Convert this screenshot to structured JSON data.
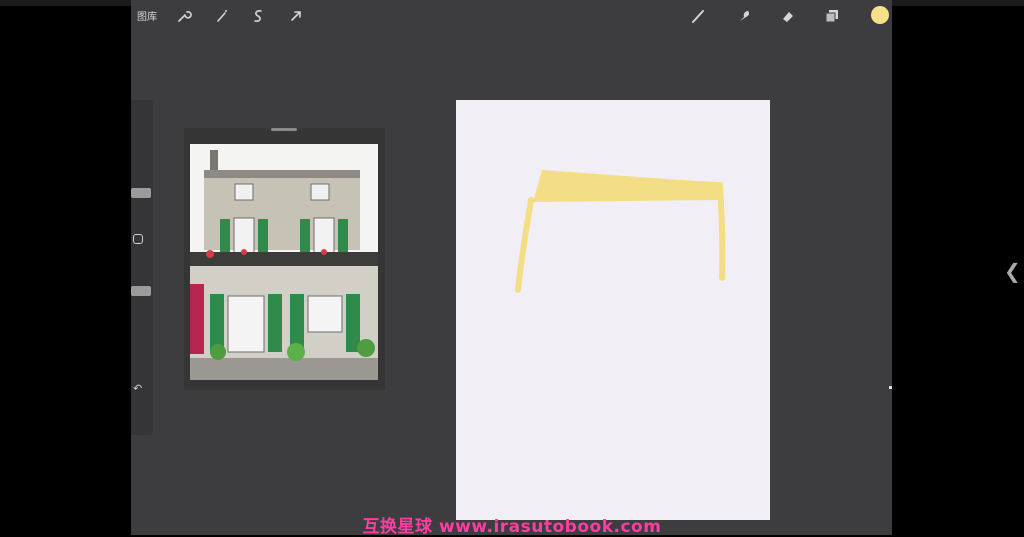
{
  "toolbar": {
    "gallery_label": "图库",
    "left_icons": [
      "wrench-icon",
      "magic-wand-icon",
      "selection-icon",
      "transform-arrow-icon"
    ],
    "right_icons": [
      "brush-icon",
      "smudge-icon",
      "eraser-icon",
      "layers-icon"
    ],
    "current_color": "#f7e08a"
  },
  "sidebar": {
    "undo_label": "↶"
  },
  "canvas": {
    "stroke_color": "#f3dd85",
    "background": "#f1eff5"
  },
  "watermark": {
    "text": "互换星球 www.irasutobook.com"
  },
  "side_chevron": "❮"
}
